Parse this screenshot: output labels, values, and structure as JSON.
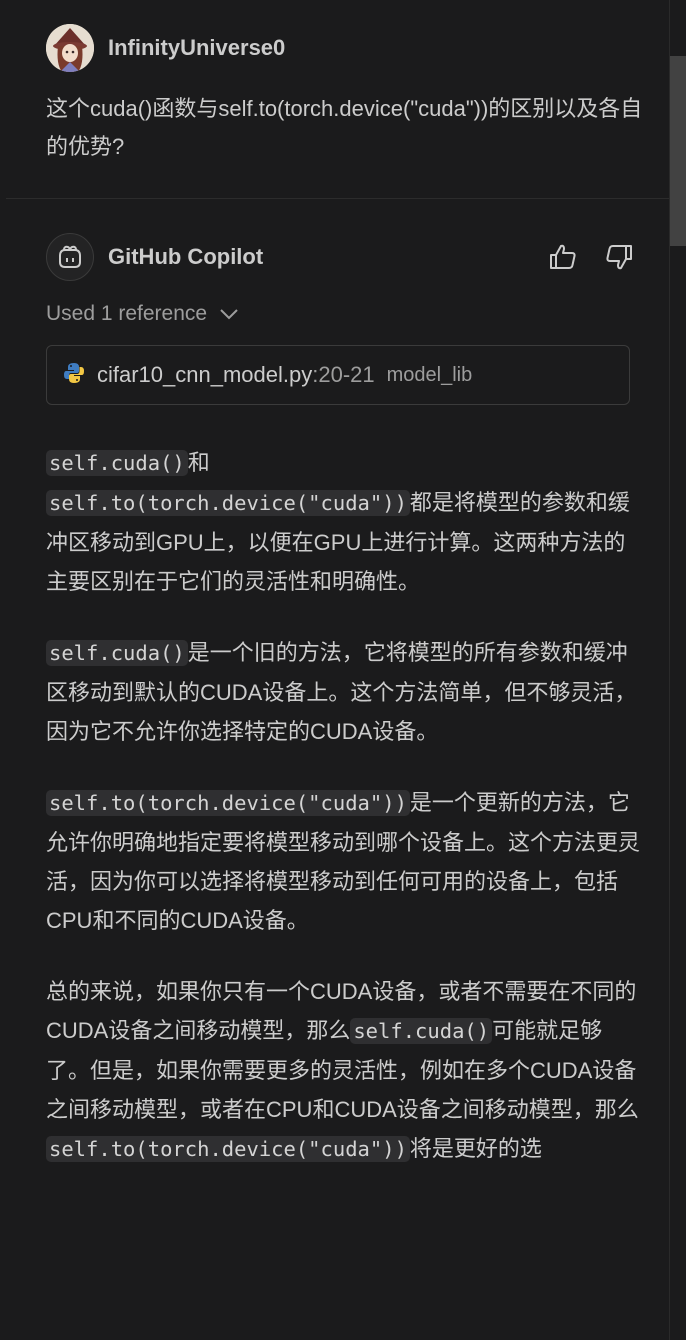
{
  "user": {
    "name": "InfinityUniverse0",
    "message": "这个cuda()函数与self.to(torch.device(\"cuda\"))的区别以及各自的优势?"
  },
  "assistant": {
    "name": "GitHub Copilot",
    "references_label": "Used 1 reference",
    "reference": {
      "file": "cifar10_cnn_model.py",
      "lines": ":20-21",
      "folder": "model_lib"
    },
    "answer": {
      "p1": {
        "code1": "self.cuda()",
        "t1": "和",
        "code2": "self.to(torch.device(\"cuda\"))",
        "t2": "都是将模型的参数和缓冲区移动到GPU上，以便在GPU上进行计算。这两种方法的主要区别在于它们的灵活性和明确性。"
      },
      "p2": {
        "code1": "self.cuda()",
        "t1": "是一个旧的方法，它将模型的所有参数和缓冲区移动到默认的CUDA设备上。这个方法简单，但不够灵活，因为它不允许你选择特定的CUDA设备。"
      },
      "p3": {
        "code1": "self.to(torch.device(\"cuda\"))",
        "t1": "是一个更新的方法，它允许你明确地指定要将模型移动到哪个设备上。这个方法更灵活，因为你可以选择将模型移动到任何可用的设备上，包括CPU和不同的CUDA设备。"
      },
      "p4": {
        "t1": "总的来说，如果你只有一个CUDA设备，或者不需要在不同的CUDA设备之间移动模型，那么",
        "code1": "self.cuda()",
        "t2": "可能就足够了。但是，如果你需要更多的灵活性，例如在多个CUDA设备之间移动模型，或者在CPU和CUDA设备之间移动模型，那么",
        "code2": "self.to(torch.device(\"cuda\"))",
        "t3": "将是更好的选"
      }
    }
  },
  "colors": {
    "background": "#1b1b1c",
    "text": "#cccccc",
    "muted": "#9d9d9d",
    "code_bg": "#2f2f31",
    "border": "#3b3b3b",
    "python_blue": "#3f7cc0",
    "python_yellow": "#f2c744"
  },
  "icons": {
    "copilot_avatar": "copilot-icon",
    "thumbs_up": "thumbs-up-icon",
    "thumbs_down": "thumbs-down-icon",
    "chevron": "chevron-down-icon",
    "file_type": "python-file-icon"
  }
}
